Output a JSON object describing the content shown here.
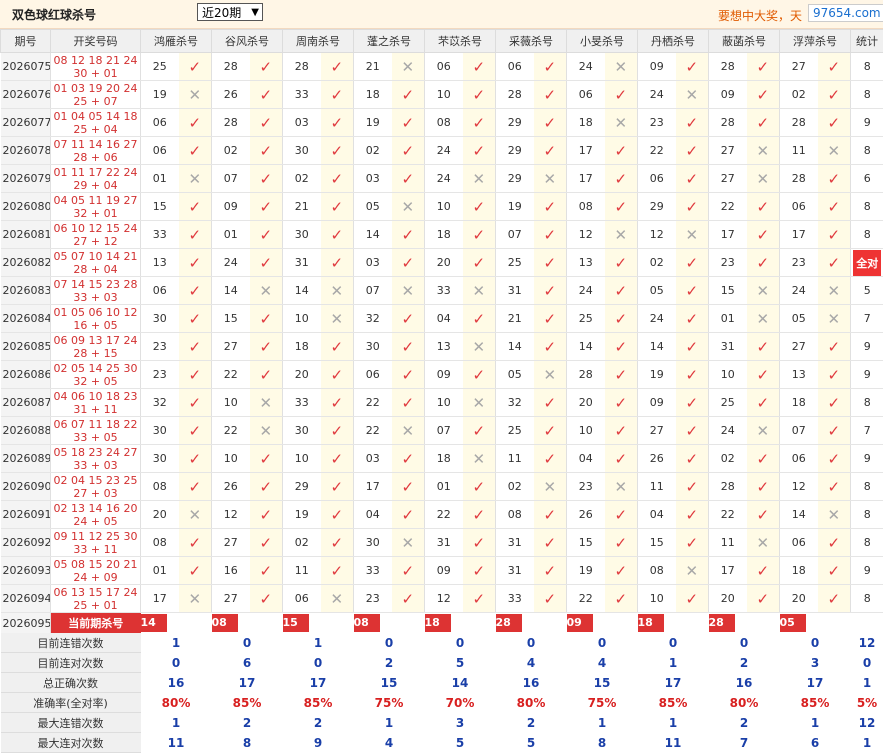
{
  "header": {
    "title": "双色球红球杀号",
    "period_select": "近20期",
    "marquee": "要想中大奖，天",
    "watermark": "97654.com"
  },
  "columns": {
    "period": "期号",
    "draw": "开奖号码",
    "experts": [
      "鸿雁杀号",
      "谷风杀号",
      "周南杀号",
      "蓬之杀号",
      "芣苡杀号",
      "采薇杀号",
      "小旻杀号",
      "丹栖杀号",
      "蔽菡杀号",
      "浮萍杀号"
    ],
    "count": "统计"
  },
  "rows": [
    {
      "period": "2026075",
      "draw1": "08 12 18 21 24",
      "draw2": "30 + 01",
      "kills": [
        "25",
        "28",
        "28",
        "21",
        "06",
        "06",
        "24",
        "09",
        "28",
        "27"
      ],
      "results": [
        1,
        1,
        1,
        0,
        1,
        1,
        0,
        1,
        1,
        1
      ],
      "count": "8"
    },
    {
      "period": "2026076",
      "draw1": "01 03 19 20 24",
      "draw2": "25 + 07",
      "kills": [
        "19",
        "26",
        "33",
        "18",
        "10",
        "28",
        "06",
        "24",
        "09",
        "02"
      ],
      "results": [
        0,
        1,
        1,
        1,
        1,
        1,
        1,
        0,
        1,
        1
      ],
      "count": "8"
    },
    {
      "period": "2026077",
      "draw1": "01 04 05 14 18",
      "draw2": "25 + 04",
      "kills": [
        "06",
        "28",
        "03",
        "19",
        "08",
        "29",
        "18",
        "23",
        "28",
        "28"
      ],
      "results": [
        1,
        1,
        1,
        1,
        1,
        1,
        0,
        1,
        1,
        1
      ],
      "count": "9"
    },
    {
      "period": "2026078",
      "draw1": "07 11 14 16 27",
      "draw2": "28 + 06",
      "kills": [
        "06",
        "02",
        "30",
        "02",
        "24",
        "29",
        "17",
        "22",
        "27",
        "11"
      ],
      "results": [
        1,
        1,
        1,
        1,
        1,
        1,
        1,
        1,
        0,
        0
      ],
      "count": "8"
    },
    {
      "period": "2026079",
      "draw1": "01 11 17 22 24",
      "draw2": "29 + 04",
      "kills": [
        "01",
        "07",
        "02",
        "03",
        "24",
        "29",
        "17",
        "06",
        "27",
        "28"
      ],
      "results": [
        0,
        1,
        1,
        1,
        0,
        0,
        1,
        1,
        0,
        1
      ],
      "count": "6"
    },
    {
      "period": "2026080",
      "draw1": "04 05 11 19 27",
      "draw2": "32 + 01",
      "kills": [
        "15",
        "09",
        "21",
        "05",
        "10",
        "19",
        "08",
        "29",
        "22",
        "06"
      ],
      "results": [
        1,
        1,
        1,
        0,
        1,
        1,
        1,
        1,
        1,
        1
      ],
      "count": "8"
    },
    {
      "period": "2026081",
      "draw1": "06 10 12 15 24",
      "draw2": "27 + 12",
      "kills": [
        "33",
        "01",
        "30",
        "14",
        "18",
        "07",
        "12",
        "12",
        "17",
        "17"
      ],
      "results": [
        1,
        1,
        1,
        1,
        1,
        1,
        0,
        0,
        1,
        1
      ],
      "count": "8"
    },
    {
      "period": "2026082",
      "draw1": "05 07 10 14 21",
      "draw2": "28 + 04",
      "kills": [
        "13",
        "24",
        "31",
        "03",
        "20",
        "25",
        "13",
        "02",
        "23",
        "23"
      ],
      "results": [
        1,
        1,
        1,
        1,
        1,
        1,
        1,
        1,
        1,
        1
      ],
      "count": "全对"
    },
    {
      "period": "2026083",
      "draw1": "07 14 15 23 28",
      "draw2": "33 + 03",
      "kills": [
        "06",
        "14",
        "14",
        "07",
        "33",
        "31",
        "24",
        "05",
        "15",
        "24"
      ],
      "results": [
        1,
        0,
        0,
        0,
        0,
        1,
        1,
        1,
        0,
        0
      ],
      "count": "5"
    },
    {
      "period": "2026084",
      "draw1": "01 05 06 10 12",
      "draw2": "16 + 05",
      "kills": [
        "30",
        "15",
        "10",
        "32",
        "04",
        "21",
        "25",
        "24",
        "01",
        "05"
      ],
      "results": [
        1,
        1,
        0,
        1,
        1,
        1,
        1,
        1,
        0,
        0
      ],
      "count": "7"
    },
    {
      "period": "2026085",
      "draw1": "06 09 13 17 24",
      "draw2": "28 + 15",
      "kills": [
        "23",
        "27",
        "18",
        "30",
        "13",
        "14",
        "14",
        "14",
        "31",
        "27"
      ],
      "results": [
        1,
        1,
        1,
        1,
        0,
        1,
        1,
        1,
        1,
        1
      ],
      "count": "9"
    },
    {
      "period": "2026086",
      "draw1": "02 05 14 25 30",
      "draw2": "32 + 05",
      "kills": [
        "23",
        "22",
        "20",
        "06",
        "09",
        "05",
        "28",
        "19",
        "10",
        "13"
      ],
      "results": [
        1,
        1,
        1,
        1,
        1,
        0,
        1,
        1,
        1,
        1
      ],
      "count": "9"
    },
    {
      "period": "2026087",
      "draw1": "04 06 10 18 23",
      "draw2": "31 + 11",
      "kills": [
        "32",
        "10",
        "33",
        "22",
        "10",
        "32",
        "20",
        "09",
        "25",
        "18"
      ],
      "results": [
        1,
        0,
        1,
        1,
        0,
        1,
        1,
        1,
        1,
        1
      ],
      "count": "8"
    },
    {
      "period": "2026088",
      "draw1": "06 07 11 18 22",
      "draw2": "33 + 05",
      "kills": [
        "30",
        "22",
        "30",
        "22",
        "07",
        "25",
        "10",
        "27",
        "24",
        "07"
      ],
      "results": [
        1,
        0,
        1,
        0,
        1,
        1,
        1,
        1,
        0,
        1
      ],
      "count": "7"
    },
    {
      "period": "2026089",
      "draw1": "05 18 23 24 27",
      "draw2": "33 + 03",
      "kills": [
        "30",
        "10",
        "10",
        "03",
        "18",
        "11",
        "04",
        "26",
        "02",
        "06"
      ],
      "results": [
        1,
        1,
        1,
        1,
        0,
        1,
        1,
        1,
        1,
        1
      ],
      "count": "9"
    },
    {
      "period": "2026090",
      "draw1": "02 04 15 23 25",
      "draw2": "27 + 03",
      "kills": [
        "08",
        "26",
        "29",
        "17",
        "01",
        "02",
        "23",
        "11",
        "28",
        "12"
      ],
      "results": [
        1,
        1,
        1,
        1,
        1,
        0,
        0,
        1,
        1,
        1
      ],
      "count": "8"
    },
    {
      "period": "2026091",
      "draw1": "02 13 14 16 20",
      "draw2": "24 + 05",
      "kills": [
        "20",
        "12",
        "19",
        "04",
        "22",
        "08",
        "26",
        "04",
        "22",
        "14"
      ],
      "results": [
        0,
        1,
        1,
        1,
        1,
        1,
        1,
        1,
        1,
        0
      ],
      "count": "8"
    },
    {
      "period": "2026092",
      "draw1": "09 11 12 25 30",
      "draw2": "33 + 11",
      "kills": [
        "08",
        "27",
        "02",
        "30",
        "31",
        "31",
        "15",
        "15",
        "11",
        "06"
      ],
      "results": [
        1,
        1,
        1,
        0,
        1,
        1,
        1,
        1,
        0,
        1
      ],
      "count": "8"
    },
    {
      "period": "2026093",
      "draw1": "05 08 15 20 21",
      "draw2": "24 + 09",
      "kills": [
        "01",
        "16",
        "11",
        "33",
        "09",
        "31",
        "19",
        "08",
        "17",
        "18"
      ],
      "results": [
        1,
        1,
        1,
        1,
        1,
        1,
        1,
        0,
        1,
        1
      ],
      "count": "9"
    },
    {
      "period": "2026094",
      "draw1": "06 13 15 17 24",
      "draw2": "25 + 01",
      "kills": [
        "17",
        "27",
        "06",
        "23",
        "12",
        "33",
        "22",
        "10",
        "20",
        "20"
      ],
      "results": [
        0,
        1,
        0,
        1,
        1,
        1,
        1,
        1,
        1,
        1
      ],
      "count": "8"
    }
  ],
  "current": {
    "period": "2026095",
    "label": "当前期杀号",
    "kills": [
      "14",
      "08",
      "15",
      "08",
      "18",
      "28",
      "09",
      "18",
      "28",
      "05"
    ]
  },
  "stats": [
    {
      "label": "目前连错次数",
      "values": [
        "1",
        "0",
        "1",
        "0",
        "0",
        "0",
        "0",
        "0",
        "0",
        "0",
        "12"
      ],
      "red": false
    },
    {
      "label": "目前连对次数",
      "values": [
        "0",
        "6",
        "0",
        "2",
        "5",
        "4",
        "4",
        "1",
        "2",
        "3",
        "0"
      ],
      "red": false
    },
    {
      "label": "总正确次数",
      "values": [
        "16",
        "17",
        "17",
        "15",
        "14",
        "16",
        "15",
        "17",
        "16",
        "17",
        "1"
      ],
      "red": false
    },
    {
      "label": "准确率(全对率)",
      "values": [
        "80%",
        "85%",
        "85%",
        "75%",
        "70%",
        "80%",
        "75%",
        "85%",
        "80%",
        "85%",
        "5%"
      ],
      "red": true
    },
    {
      "label": "最大连错次数",
      "values": [
        "1",
        "2",
        "2",
        "1",
        "3",
        "2",
        "1",
        "1",
        "2",
        "1",
        "12"
      ],
      "red": false
    },
    {
      "label": "最大连对次数",
      "values": [
        "11",
        "8",
        "9",
        "4",
        "5",
        "5",
        "8",
        "11",
        "7",
        "6",
        "1"
      ],
      "red": false
    }
  ],
  "marks": {
    "ok": "✓",
    "no": "✕"
  }
}
